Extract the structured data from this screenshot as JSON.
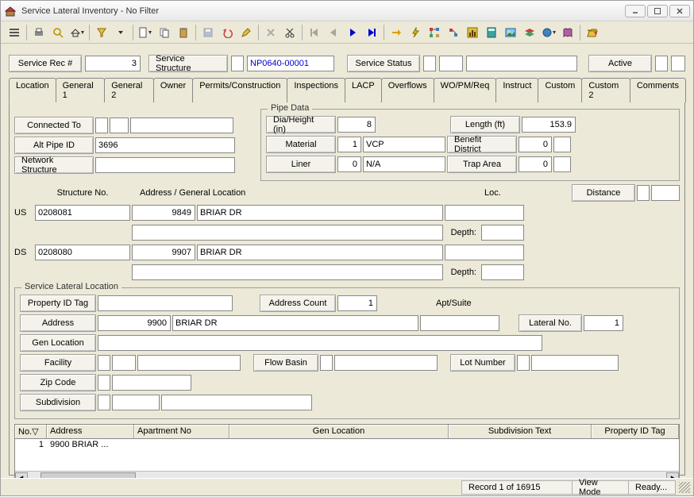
{
  "window": {
    "title": "Service Lateral Inventory - No Filter"
  },
  "header": {
    "service_rec_label": "Service Rec #",
    "service_rec_value": "3",
    "service_structure_label": "Service Structure",
    "service_structure_value": "NP0640-00001",
    "service_status_label": "Service Status",
    "active_label": "Active"
  },
  "tabs": [
    "Location",
    "General 1",
    "General 2",
    "Owner",
    "Permits/Construction",
    "Inspections",
    "LACP",
    "Overflows",
    "WO/PM/Req",
    "Instruct",
    "Custom",
    "Custom 2",
    "Comments"
  ],
  "location": {
    "connected_to_label": "Connected To",
    "alt_pipe_id_label": "Alt Pipe ID",
    "alt_pipe_id_value": "3696",
    "network_structure_label": "Network Structure",
    "pipe_data_legend": "Pipe Data",
    "dia_label": "Dia/Height (in)",
    "dia_value": "8",
    "length_label": "Length (ft)",
    "length_value": "153.9",
    "material_label": "Material",
    "material_code": "1",
    "material_value": "VCP",
    "benefit_label": "Benefit District",
    "benefit_value": "0",
    "liner_label": "Liner",
    "liner_code": "0",
    "liner_value": "N/A",
    "trap_label": "Trap Area",
    "trap_value": "0",
    "structure_no_label": "Structure No.",
    "address_loc_label": "Address / General Location",
    "loc_label": "Loc.",
    "distance_label": "Distance",
    "us_label": "US",
    "us_structure": "0208081",
    "us_addr_no": "9849",
    "us_addr_street": "BRIAR DR",
    "depth_label": "Depth:",
    "ds_label": "DS",
    "ds_structure": "0208080",
    "ds_addr_no": "9907",
    "ds_addr_street": "BRIAR DR"
  },
  "sll": {
    "legend": "Service Lateral Location",
    "property_id_label": "Property ID Tag",
    "address_count_label": "Address Count",
    "address_count_value": "1",
    "apt_label": "Apt/Suite",
    "address_label": "Address",
    "address_no": "9900",
    "address_street": "BRIAR DR",
    "lateral_no_label": "Lateral No.",
    "lateral_no_value": "1",
    "gen_location_label": "Gen Location",
    "facility_label": "Facility",
    "flow_basin_label": "Flow Basin",
    "lot_number_label": "Lot Number",
    "zip_label": "Zip Code",
    "subdivision_label": "Subdivision"
  },
  "grid": {
    "cols": [
      "No.",
      "Address",
      "Apartment No",
      "Gen Location",
      "Subdivision Text",
      "Property ID Tag"
    ],
    "sort_icon": "▽",
    "rows": [
      {
        "no": "1",
        "address": "9900 BRIAR ...",
        "apt": "",
        "gen": "",
        "sub": "",
        "pid": ""
      }
    ]
  },
  "status": {
    "record": "Record 1 of 16915",
    "mode": "View Mode",
    "ready": "Ready..."
  }
}
